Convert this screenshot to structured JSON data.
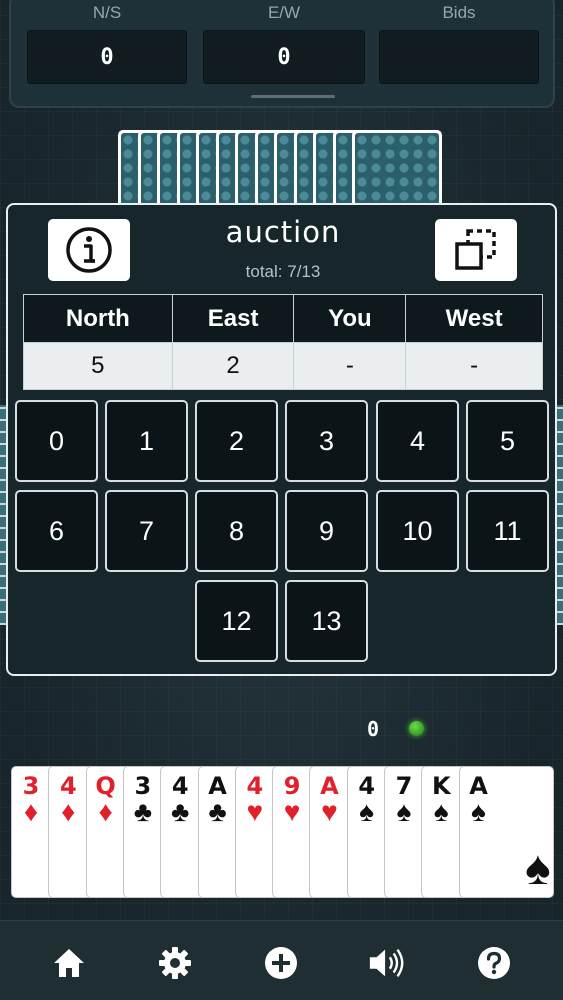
{
  "scoreboard": {
    "ns_label": "N/S",
    "ns_value": "0",
    "ew_label": "E/W",
    "ew_value": "0",
    "bids_label": "Bids",
    "bids_value": ""
  },
  "auction": {
    "title": "auction",
    "subtitle": "total: 7/13",
    "columns": [
      "North",
      "East",
      "You",
      "West"
    ],
    "row": [
      "5",
      "2",
      "-",
      "-"
    ],
    "bid_options": [
      "0",
      "1",
      "2",
      "3",
      "4",
      "5",
      "6",
      "7",
      "8",
      "9",
      "10",
      "11",
      "12",
      "13"
    ]
  },
  "status": {
    "tricks": "0",
    "turn_indicator_color": "#3fbf2c"
  },
  "hand": [
    {
      "rank": "3",
      "suit": "♦",
      "color": "red"
    },
    {
      "rank": "4",
      "suit": "♦",
      "color": "red"
    },
    {
      "rank": "Q",
      "suit": "♦",
      "color": "red"
    },
    {
      "rank": "3",
      "suit": "♣",
      "color": "black"
    },
    {
      "rank": "4",
      "suit": "♣",
      "color": "black"
    },
    {
      "rank": "A",
      "suit": "♣",
      "color": "black"
    },
    {
      "rank": "4",
      "suit": "♥",
      "color": "red"
    },
    {
      "rank": "9",
      "suit": "♥",
      "color": "red"
    },
    {
      "rank": "A",
      "suit": "♥",
      "color": "red"
    },
    {
      "rank": "4",
      "suit": "♠",
      "color": "black"
    },
    {
      "rank": "7",
      "suit": "♠",
      "color": "black"
    },
    {
      "rank": "K",
      "suit": "♠",
      "color": "black"
    },
    {
      "rank": "A",
      "suit": "♠",
      "color": "black"
    }
  ],
  "opponent_card_count": 13,
  "nav": {
    "items": [
      "home-icon",
      "gear-icon",
      "plus-circle-icon",
      "speaker-icon",
      "help-icon"
    ]
  },
  "colors": {
    "background": "#1c2b31",
    "dialog": "#17262b",
    "red_suit": "#e0202a"
  }
}
